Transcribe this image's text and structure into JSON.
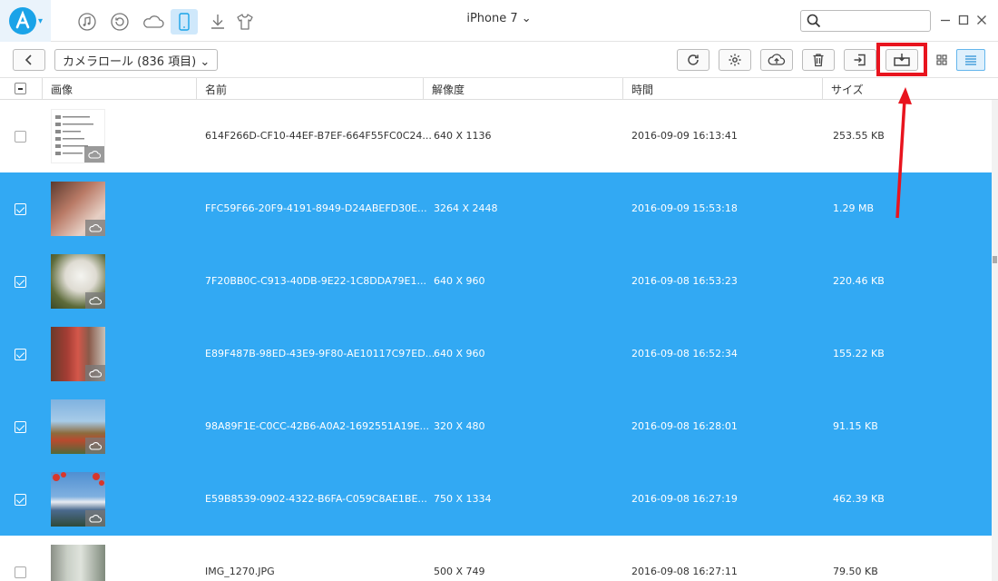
{
  "device": {
    "name": "iPhone 7 ⌄"
  },
  "toolbar": {
    "album_label": "カメラロール (836 項目) ⌄"
  },
  "columns": [
    "画像",
    "名前",
    "解像度",
    "時間",
    "サイズ"
  ],
  "rows": [
    {
      "name": "614F266D-CF10-44EF-B7EF-664F55FC0C24...",
      "resolution": "640 X 1136",
      "time": "2016-09-09 16:13:41",
      "size": "253.55 KB",
      "selected": false
    },
    {
      "name": "FFC59F66-20F9-4191-8949-D24ABEFD30E...",
      "resolution": "3264 X 2448",
      "time": "2016-09-09 15:53:18",
      "size": "1.29 MB",
      "selected": true
    },
    {
      "name": "7F20BB0C-C913-40DB-9E22-1C8DDA79E1...",
      "resolution": "640 X 960",
      "time": "2016-09-08 16:53:23",
      "size": "220.46 KB",
      "selected": true
    },
    {
      "name": "E89F487B-98ED-43E9-9F80-AE10117C97ED...",
      "resolution": "640 X 960",
      "time": "2016-09-08 16:52:34",
      "size": "155.22 KB",
      "selected": true
    },
    {
      "name": "98A89F1E-C0CC-42B6-A0A2-1692551A19E...",
      "resolution": "320 X 480",
      "time": "2016-09-08 16:28:01",
      "size": "91.15 KB",
      "selected": true
    },
    {
      "name": "E59B8539-0902-4322-B6FA-C059C8AE1BE...",
      "resolution": "750 X 1334",
      "time": "2016-09-08 16:27:19",
      "size": "462.39 KB",
      "selected": true
    },
    {
      "name": "IMG_1270.JPG",
      "resolution": "500 X 749",
      "time": "2016-09-08 16:27:11",
      "size": "79.50 KB",
      "selected": false
    }
  ],
  "colors": {
    "accent": "#1aa3e8",
    "selection": "#32a9f3",
    "highlight": "#e8141e"
  }
}
